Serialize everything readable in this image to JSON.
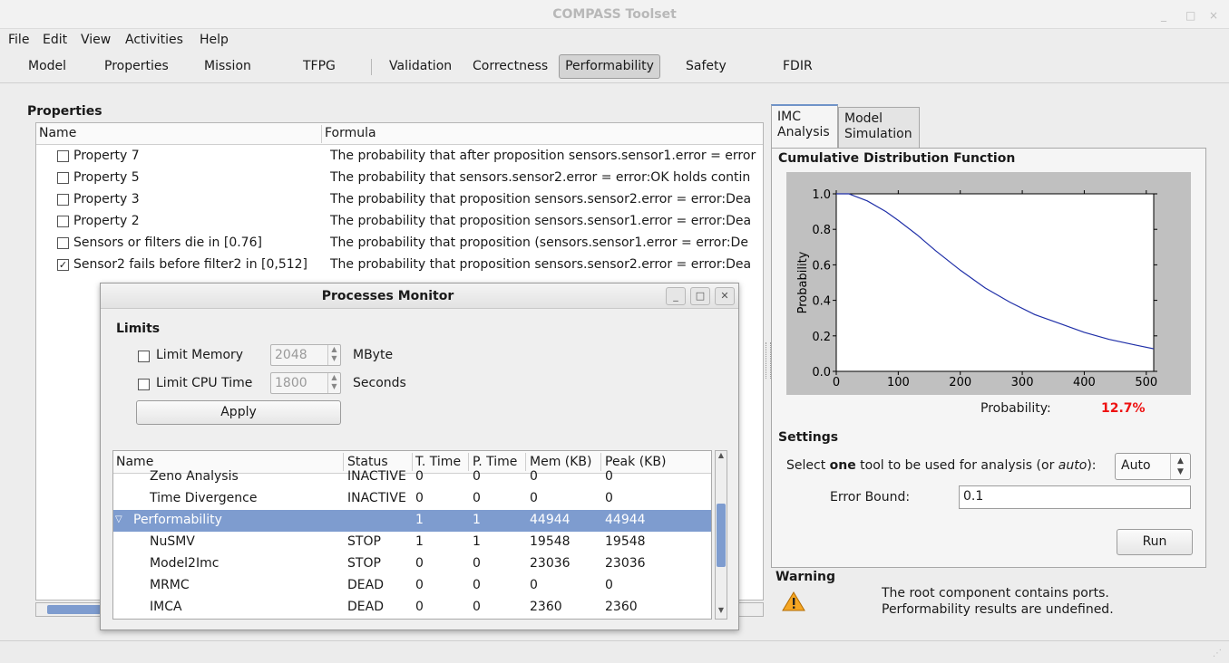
{
  "window": {
    "title": "COMPASS Toolset",
    "controls": [
      "_",
      "□",
      "×"
    ]
  },
  "menu": [
    "File",
    "Edit",
    "View",
    "Activities",
    "Help"
  ],
  "toolbar": {
    "items": [
      "Model",
      "Properties",
      "Mission",
      "TFPG",
      "Validation",
      "Correctness",
      "Performability",
      "Safety",
      "FDIR"
    ],
    "active": "Performability"
  },
  "properties": {
    "heading": "Properties",
    "col_name": "Name",
    "col_formula": "Formula",
    "rows": [
      {
        "name": "Property 7",
        "checked": false,
        "formula": "The probability that after proposition sensors.sensor1.error = error"
      },
      {
        "name": "Property 5",
        "checked": false,
        "formula": "The probability that sensors.sensor2.error = error:OK holds contin"
      },
      {
        "name": "Property 3",
        "checked": false,
        "formula": "The probability that proposition sensors.sensor2.error = error:Dea"
      },
      {
        "name": "Property 2",
        "checked": false,
        "formula": "The probability that proposition sensors.sensor1.error = error:Dea"
      },
      {
        "name": "Sensors or filters die in [0.76]",
        "checked": false,
        "formula": "The probability that proposition (sensors.sensor1.error = error:De"
      },
      {
        "name": "Sensor2 fails before filter2 in [0,512]",
        "checked": true,
        "formula": "The probability that proposition sensors.sensor2.error = error:Dea"
      }
    ]
  },
  "monitor": {
    "title": "Processes Monitor",
    "limits_heading": "Limits",
    "limit_memory_label": "Limit Memory",
    "limit_memory_value": "2048",
    "limit_memory_unit": "MByte",
    "limit_cpu_label": "Limit CPU Time",
    "limit_cpu_value": "1800",
    "limit_cpu_unit": "Seconds",
    "apply_label": "Apply",
    "columns": [
      "Name",
      "Status",
      "T. Time",
      "P. Time",
      "Mem (KB)",
      "Peak (KB)"
    ],
    "rows": [
      {
        "name": "Zeno Analysis",
        "status": "INACTIVE",
        "t": "0",
        "p": "0",
        "mem": "0",
        "peak": "0",
        "indent": 2
      },
      {
        "name": "Time Divergence",
        "status": "INACTIVE",
        "t": "0",
        "p": "0",
        "mem": "0",
        "peak": "0",
        "indent": 2
      },
      {
        "name": "Performability",
        "status": "",
        "t": "1",
        "p": "1",
        "mem": "44944",
        "peak": "44944",
        "indent": 1,
        "selected": true
      },
      {
        "name": "NuSMV",
        "status": "STOP",
        "t": "1",
        "p": "1",
        "mem": "19548",
        "peak": "19548",
        "indent": 2
      },
      {
        "name": "Model2Imc",
        "status": "STOP",
        "t": "0",
        "p": "0",
        "mem": "23036",
        "peak": "23036",
        "indent": 2
      },
      {
        "name": "MRMC",
        "status": "DEAD",
        "t": "0",
        "p": "0",
        "mem": "0",
        "peak": "0",
        "indent": 2
      },
      {
        "name": "IMCA",
        "status": "DEAD",
        "t": "0",
        "p": "0",
        "mem": "2360",
        "peak": "2360",
        "indent": 2
      }
    ]
  },
  "right": {
    "tabs": [
      {
        "line1": "IMC",
        "line2": "Analysis"
      },
      {
        "line1": "Model",
        "line2": "Simulation"
      }
    ],
    "cdf_heading": "Cumulative Distribution Function",
    "probability_label": "Probability:",
    "probability_value": "12.7%",
    "settings_heading": "Settings",
    "tool_label_pre": "Select ",
    "tool_label_bold": "one",
    "tool_label_mid": " tool to be used for analysis (or ",
    "tool_label_ital": "auto",
    "tool_label_post": "):",
    "tool_value": "Auto",
    "error_bound_label": "Error Bound:",
    "error_bound_value": "0.1",
    "run_label": "Run",
    "warning_heading": "Warning",
    "warning_line1": "The root component contains ports.",
    "warning_line2": "Performability results are undefined."
  },
  "chart_data": {
    "type": "line",
    "ylabel": "Probability",
    "xlabel": "",
    "xlim": [
      0,
      512
    ],
    "ylim": [
      0,
      1.0
    ],
    "xticks": [
      0,
      100,
      200,
      300,
      400,
      500
    ],
    "yticks": [
      0.0,
      0.2,
      0.4,
      0.6,
      0.8,
      1.0
    ],
    "ytick_labels": [
      "0.0",
      "0.2",
      "0.4",
      "0.6",
      "0.8",
      "1.0"
    ],
    "series": [
      {
        "color": "#1f2fa8",
        "x": [
          0,
          20,
          50,
          80,
          100,
          130,
          160,
          200,
          240,
          280,
          320,
          360,
          400,
          440,
          480,
          512
        ],
        "y": [
          1.0,
          1.0,
          0.96,
          0.9,
          0.85,
          0.77,
          0.68,
          0.57,
          0.47,
          0.39,
          0.32,
          0.27,
          0.22,
          0.18,
          0.15,
          0.127
        ]
      }
    ]
  }
}
